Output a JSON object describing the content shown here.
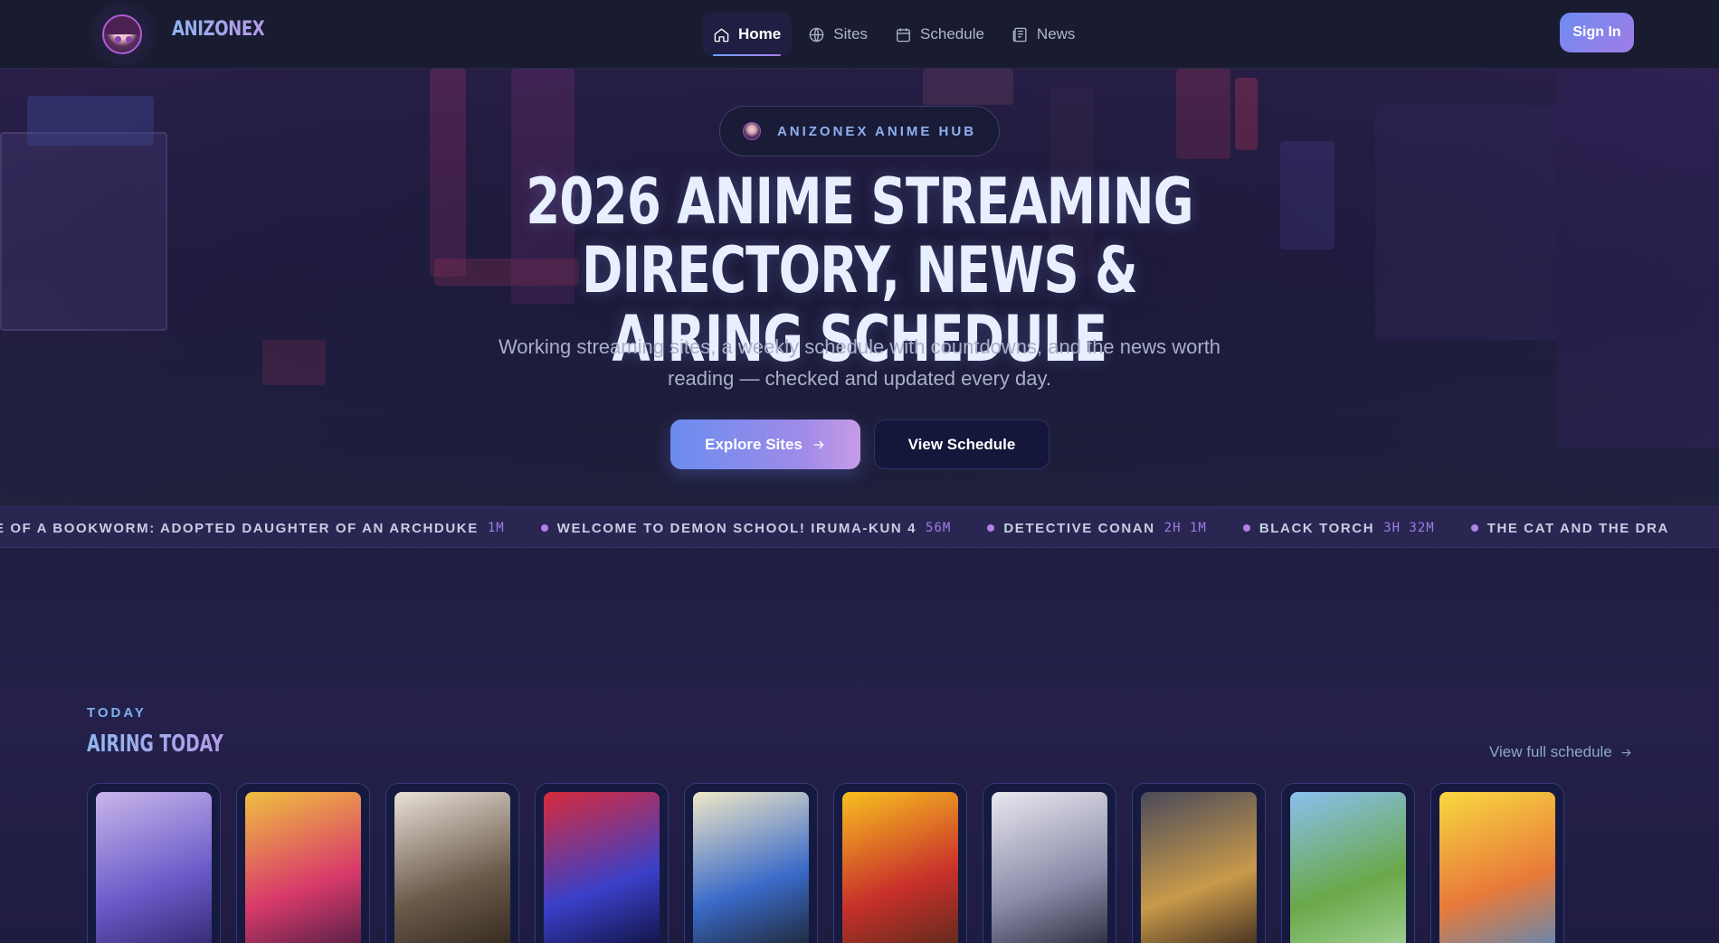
{
  "brand": {
    "name": "ANIZONEX",
    "logo_icon": "avatar-logo-icon"
  },
  "nav": {
    "items": [
      {
        "label": "Home",
        "icon": "home-icon",
        "active": true
      },
      {
        "label": "Sites",
        "icon": "globe-icon",
        "active": false
      },
      {
        "label": "Schedule",
        "icon": "calendar-icon",
        "active": false
      },
      {
        "label": "News",
        "icon": "newspaper-icon",
        "active": false
      }
    ],
    "sign_in": "Sign In"
  },
  "hero": {
    "pill": "ANIZONEX ANIME HUB",
    "title_line1": "2026 ANIME STREAMING DIRECTORY, NEWS &",
    "title_line2": "AIRING SCHEDULE",
    "subtitle_line1": "Working streaming sites, a weekly schedule with countdowns, and the news worth",
    "subtitle_line2": "reading — checked and updated every day.",
    "cta_primary": "Explore Sites",
    "cta_secondary": "View Schedule"
  },
  "ticker": [
    {
      "title": "E OF A BOOKWORM: ADOPTED DAUGHTER OF AN ARCHDUKE",
      "time": "1M"
    },
    {
      "title": "WELCOME TO DEMON SCHOOL! IRUMA-KUN 4",
      "time": "56M"
    },
    {
      "title": "DETECTIVE CONAN",
      "time": "2H 1M"
    },
    {
      "title": "BLACK TORCH",
      "time": "3H 32M"
    },
    {
      "title": "THE CAT AND THE DRA",
      "time": ""
    }
  ],
  "airing": {
    "kicker": "TODAY",
    "title": "AIRING TODAY",
    "view_all": "View full schedule",
    "posters": [
      {
        "colors": [
          "#c8b6ea",
          "#6a5ac8",
          "#2a2060"
        ]
      },
      {
        "colors": [
          "#f0c040",
          "#d83a6a",
          "#3a1a40"
        ]
      },
      {
        "colors": [
          "#e8e0d8",
          "#6a5a4a",
          "#2a2018"
        ]
      },
      {
        "colors": [
          "#d82a3a",
          "#3a40c8",
          "#0a0a28"
        ]
      },
      {
        "colors": [
          "#f0e8c8",
          "#3a6ac8",
          "#1a1a1a"
        ]
      },
      {
        "colors": [
          "#f8c020",
          "#c8302a",
          "#4a2a1a"
        ]
      },
      {
        "colors": [
          "#e8e8f0",
          "#8a8aa8",
          "#1a1a2a"
        ]
      },
      {
        "colors": [
          "#4a4a5a",
          "#c89a4a",
          "#2a1a1a"
        ]
      },
      {
        "colors": [
          "#8ac0f0",
          "#6aa84a",
          "#a8d8a0"
        ]
      },
      {
        "colors": [
          "#f8d840",
          "#e87a3a",
          "#4a8ac8"
        ]
      }
    ]
  }
}
